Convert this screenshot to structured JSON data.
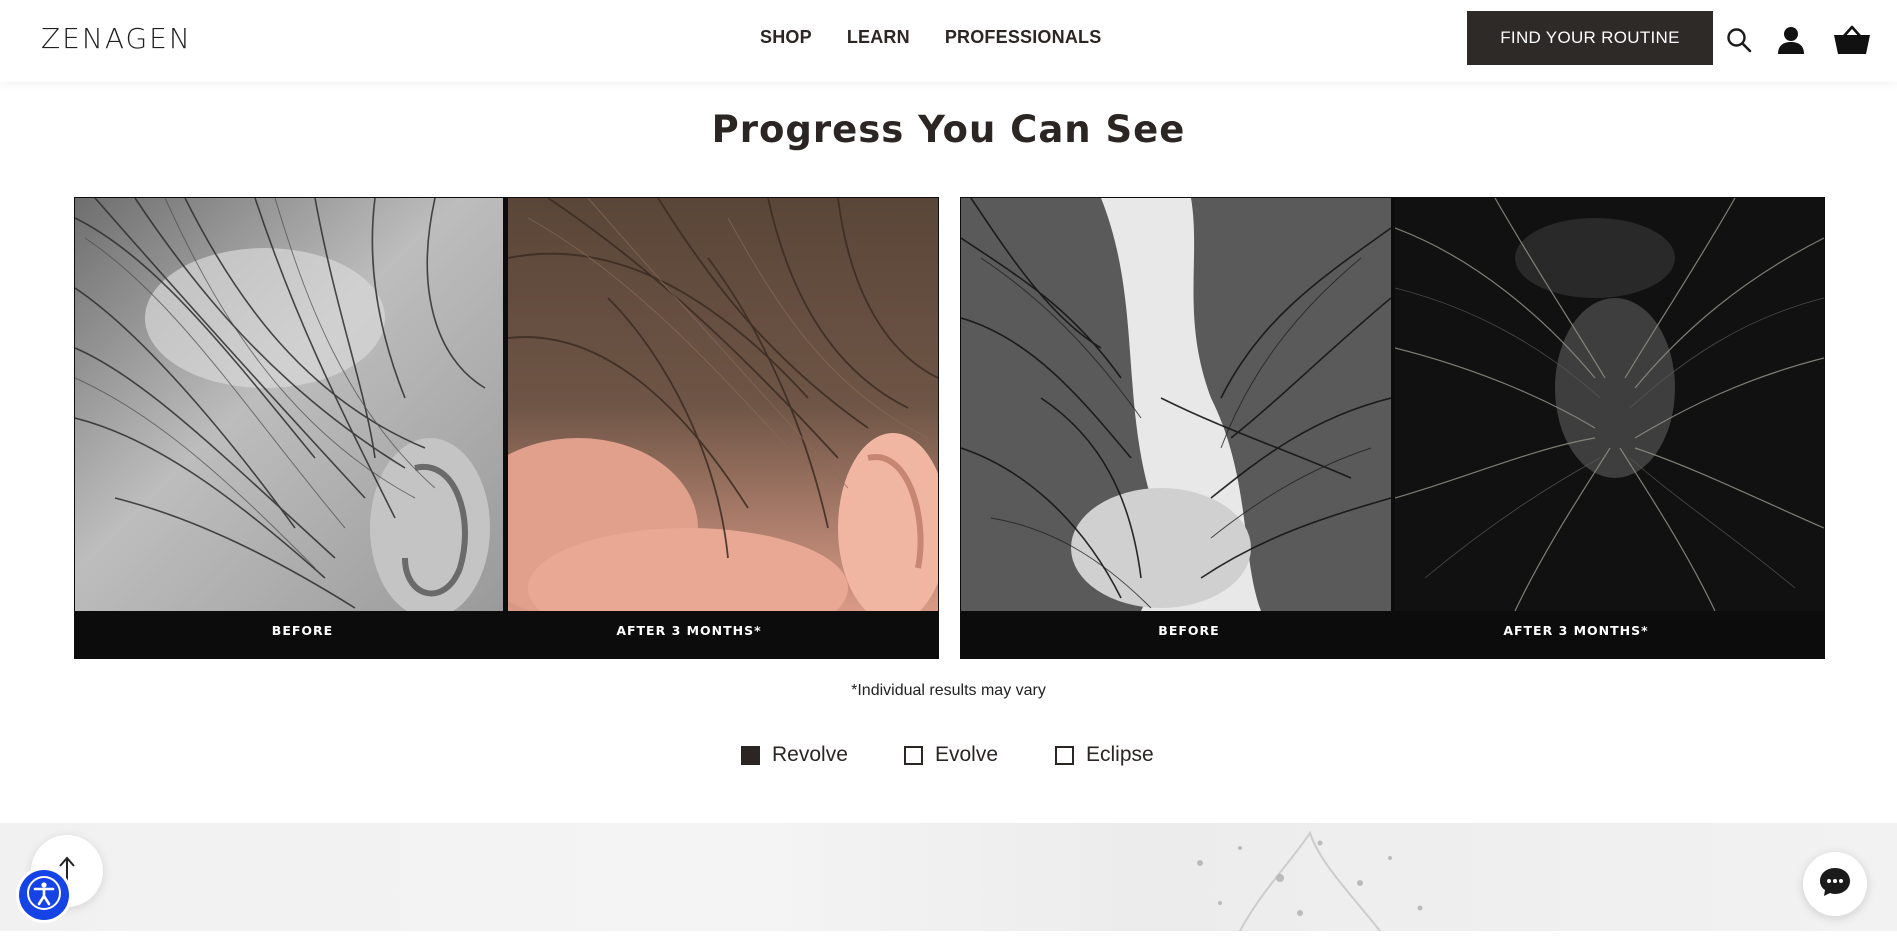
{
  "brand": {
    "logo_text": "ZENAGEN"
  },
  "nav": {
    "items": [
      "SHOP",
      "LEARN",
      "PROFESSIONALS"
    ]
  },
  "header": {
    "cta_label": "FIND YOUR ROUTINE",
    "icons": [
      "search-icon",
      "account-icon",
      "cart-icon"
    ]
  },
  "section": {
    "title": "Progress You Can See",
    "comparisons": [
      {
        "before_label": "BEFORE",
        "after_label": "AFTER 3 MONTHS*"
      },
      {
        "before_label": "BEFORE",
        "after_label": "AFTER 3 MONTHS*"
      }
    ],
    "disclaimer": "*Individual results may vary"
  },
  "product_selector": {
    "options": [
      {
        "label": "Revolve",
        "checked": true
      },
      {
        "label": "Evolve",
        "checked": false
      },
      {
        "label": "Eclipse",
        "checked": false
      }
    ]
  },
  "floating": {
    "icons": [
      "arrow-up-icon",
      "accessibility-icon",
      "chat-icon"
    ]
  },
  "colors": {
    "header_button": "#2e2a27",
    "text_dark": "#2b2623",
    "caption_bar": "#0c0c0c",
    "accessibility": "#1543e6"
  }
}
